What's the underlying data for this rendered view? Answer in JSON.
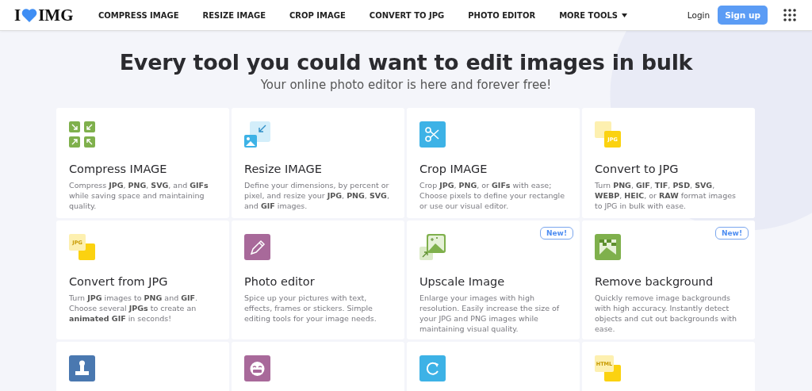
{
  "logo": {
    "left": "I",
    "right": "IMG"
  },
  "nav": [
    {
      "label": "COMPRESS IMAGE",
      "kind": "link"
    },
    {
      "label": "RESIZE IMAGE",
      "kind": "link"
    },
    {
      "label": "CROP IMAGE",
      "kind": "link"
    },
    {
      "label": "CONVERT TO JPG",
      "kind": "link"
    },
    {
      "label": "PHOTO EDITOR",
      "kind": "link"
    },
    {
      "label": "MORE TOOLS",
      "kind": "dropdown"
    }
  ],
  "login": "Login",
  "signup": "Sign up",
  "hero": {
    "title": "Every tool you could want to edit images in bulk",
    "subtitle": "Your online photo editor is here and forever free!"
  },
  "tools": [
    {
      "kind": "compress",
      "title": "Compress IMAGE",
      "description": "Compress **JPG**, **PNG**, **SVG**, and **GIFs** while saving space and maintaining quality."
    },
    {
      "kind": "resize",
      "title": "Resize IMAGE",
      "description": "Define your dimensions, by percent or pixel, and resize your **JPG**, **PNG**, **SVG**, and **GIF** images."
    },
    {
      "kind": "crop",
      "title": "Crop IMAGE",
      "description": "Crop **JPG**, **PNG**, or **GIFs** with ease; Choose pixels to define your rectangle or use our visual editor."
    },
    {
      "kind": "to-jpg",
      "icon_label": "JPG",
      "title": "Convert to JPG",
      "description": "Turn **PNG**, **GIF**, **TIF**, **PSD**, **SVG**, **WEBP**, **HEIC**, or **RAW** format images to JPG in bulk with ease."
    },
    {
      "kind": "from-jpg",
      "icon_label": "JPG",
      "title": "Convert from JPG",
      "description": "Turn **JPG** images to **PNG** and **GIF**. Choose several **JPGs** to create an **animated GIF** in seconds!"
    },
    {
      "kind": "editor",
      "title": "Photo editor",
      "description": "Spice up your pictures with text, effects, frames or stickers. Simple editing tools for your image needs."
    },
    {
      "kind": "upscale",
      "badge": "New!",
      "title": "Upscale Image",
      "description": "Enlarge your images with high resolution. Easily increase the size of your JPG and PNG images while maintaining visual quality."
    },
    {
      "kind": "remove-bg",
      "badge": "New!",
      "title": "Remove background",
      "description": "Quickly remove image backgrounds with high accuracy. Instantly detect objects and cut out backgrounds with ease."
    },
    {
      "kind": "stamp"
    },
    {
      "kind": "meme"
    },
    {
      "kind": "rotate"
    },
    {
      "kind": "html",
      "icon_label": "HTML"
    }
  ]
}
